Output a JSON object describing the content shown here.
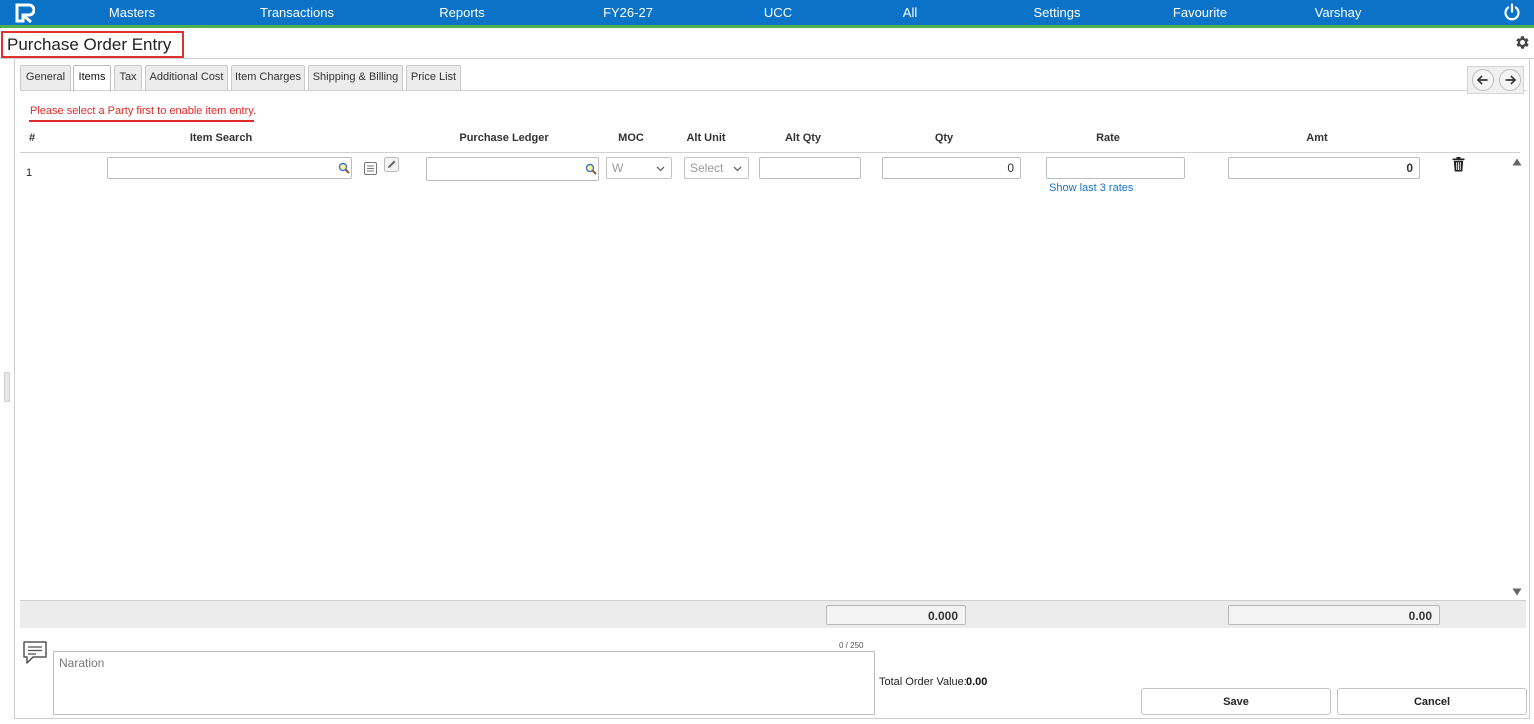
{
  "nav": {
    "items": [
      "Masters",
      "Transactions",
      "Reports",
      "FY26-27",
      "UCC",
      "All",
      "Settings",
      "Favourite",
      "Varshay"
    ]
  },
  "page": {
    "title": "Purchase Order Entry"
  },
  "tabs": [
    "General",
    "Items",
    "Tax",
    "Additional Cost",
    "Item Charges",
    "Shipping & Billing",
    "Price List"
  ],
  "active_tab": "Items",
  "warning": "Please select a Party first to enable item entry.",
  "columns": {
    "num": "#",
    "item_search": "Item Search",
    "purchase_ledger": "Purchase Ledger",
    "moc": "MOC",
    "alt_unit": "Alt Unit",
    "alt_qty": "Alt Qty",
    "qty": "Qty",
    "rate": "Rate",
    "amt": "Amt"
  },
  "row": {
    "num": "1",
    "moc": "W",
    "alt_unit": "Select",
    "qty": "0",
    "amt": "0",
    "rates_link": "Show last 3 rates"
  },
  "totals": {
    "qty": "0.000",
    "amt": "0.00"
  },
  "narration": {
    "counter": "0 / 250",
    "placeholder": "Naration"
  },
  "order": {
    "total_label": "Total Order Value:",
    "total_value": "0.00"
  },
  "buttons": {
    "save": "Save",
    "cancel": "Cancel"
  },
  "colors": {
    "nav_bg": "#0a73c8",
    "accent_green": "#4caf50",
    "warning": "#e02b2b",
    "link": "#1a73c8"
  }
}
